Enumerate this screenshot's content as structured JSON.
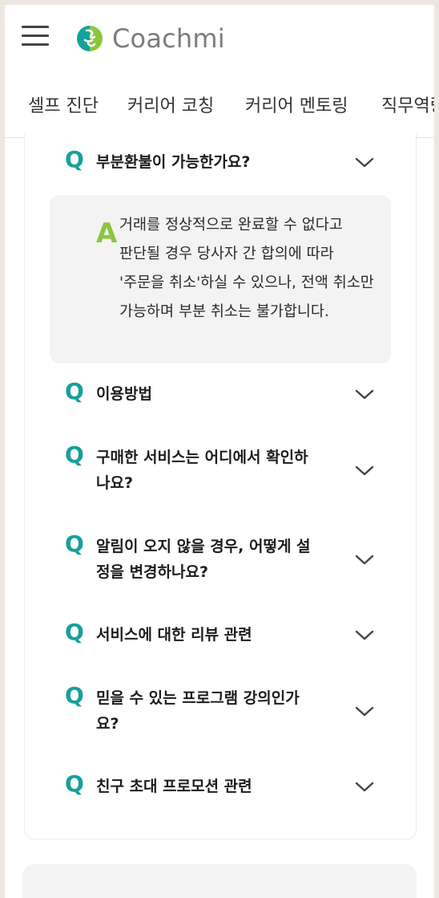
{
  "header": {
    "brand": "Coachmi",
    "menu_icon": "hamburger-icon",
    "logo_icon": "coachmi-logo-icon"
  },
  "nav": {
    "items": [
      "셀프 진단",
      "커리어 코칭",
      "커리어 멘토링",
      "직무역량"
    ]
  },
  "faq": {
    "q_marker": "Q",
    "a_marker": "A",
    "items": [
      {
        "question": "부분환불이 가능한가요?",
        "expanded": true,
        "answer": "거래를 정상적으로 완료할 수 없다고 판단될 경우 당사자 간 합의에 따라 '주문을 취소'하실 수 있으나, 전액 취소만 가능하며 부분 취소는 불가합니다."
      },
      {
        "question": "이용방법",
        "expanded": false
      },
      {
        "question": "구매한 서비스는 어디에서 확인하나요?",
        "expanded": false
      },
      {
        "question": "알림이 오지 않을 경우, 어떻게 설정을 변경하나요?",
        "expanded": false
      },
      {
        "question": "서비스에 대한 리뷰 관련",
        "expanded": false
      },
      {
        "question": "믿을 수 있는 프로그램 강의인가요?",
        "expanded": false
      },
      {
        "question": "친구 초대 프로모션 관련",
        "expanded": false
      }
    ]
  },
  "colors": {
    "q_accent": "#15a09a",
    "a_accent": "#8cc63f",
    "logo_text": "#7c7c7c"
  }
}
